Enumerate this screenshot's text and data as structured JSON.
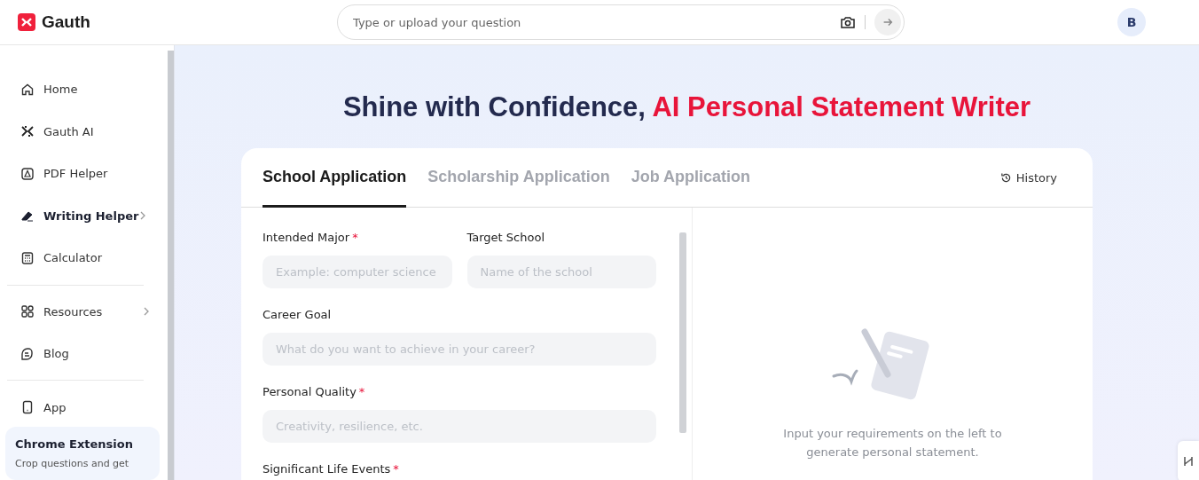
{
  "header": {
    "logo": "Gauth",
    "search": {
      "placeholder": "Type or upload your question"
    },
    "avatar": "B"
  },
  "sidebar": {
    "groups": [
      [
        {
          "label": "Home",
          "selected": false,
          "has_arrow": false
        },
        {
          "label": "Gauth AI",
          "selected": false,
          "has_arrow": false
        },
        {
          "label": "PDF Helper",
          "selected": false,
          "has_arrow": false
        },
        {
          "label": "Writing Helper",
          "selected": true,
          "has_arrow": true
        },
        {
          "label": "Calculator",
          "selected": false,
          "has_arrow": false
        }
      ],
      [
        {
          "label": "Resources",
          "selected": false,
          "has_arrow": true
        },
        {
          "label": "Blog",
          "selected": false,
          "has_arrow": false
        }
      ],
      [
        {
          "label": "App",
          "selected": false,
          "has_arrow": false
        }
      ]
    ],
    "promo": {
      "title": "Chrome Extension",
      "text": "Crop questions and get"
    }
  },
  "headline": {
    "plain": "Shine with Confidence,",
    "accent": "AI Personal Statement Writer"
  },
  "tabs": [
    {
      "label": "School Application",
      "selected": true
    },
    {
      "label": "Scholarship Application",
      "selected": false
    },
    {
      "label": "Job Application",
      "selected": false
    }
  ],
  "history": "History",
  "form": {
    "rows": [
      [
        {
          "label": "Intended Major",
          "required_mark": "*",
          "placeholder": "Example: computer science"
        },
        {
          "label": "Target School",
          "placeholder": "Name of the school"
        }
      ],
      [
        {
          "label": "Career Goal",
          "placeholder": "What do you want to achieve in your career?"
        }
      ],
      [
        {
          "label": "Personal Quality",
          "required_mark": "*",
          "placeholder": "Creativity, resilience, etc."
        }
      ],
      [
        {
          "label": "Significant Life Events",
          "required_mark": "*"
        }
      ]
    ]
  },
  "empty_state": {
    "text": "Input your requirements on the left to generate personal statement."
  }
}
